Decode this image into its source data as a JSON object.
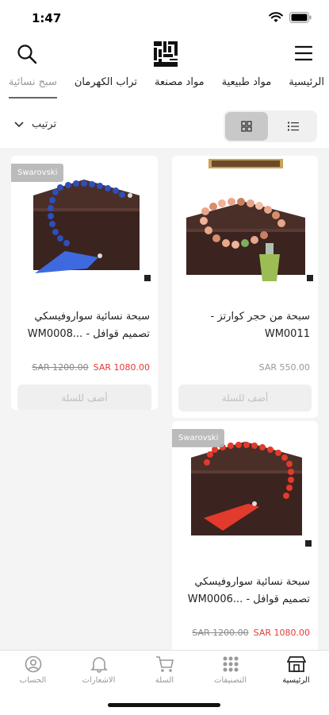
{
  "status": {
    "time": "1:47"
  },
  "header": {
    "logo_alt": "logo-icon"
  },
  "categories": [
    {
      "label": "الرئيسية",
      "active": false
    },
    {
      "label": "مواد طبيعية",
      "active": false
    },
    {
      "label": "مواد مصنعة",
      "active": false
    },
    {
      "label": "تراب الكهرمان",
      "active": false
    },
    {
      "label": "سبح نسائية",
      "active": true
    }
  ],
  "toolbar": {
    "sort_label": "ترتيب"
  },
  "products": [
    {
      "badge": "",
      "title": "سبحة من حجر كوارتز - WM0011",
      "price_old": "",
      "price_new": "SAR 550.00",
      "add_label": "أضف للسلة"
    },
    {
      "badge": "Swarovski",
      "title": "سبحة نسائية سواروفيسكي تصميم قوافل - ...WM0008",
      "price_old": "SAR 1200.00",
      "price_new": "SAR 1080.00",
      "add_label": "أضف للسلة"
    },
    {
      "badge": "Swarovski",
      "title": "سبحة نسائية سواروفيسكي تصميم قوافل - ...WM0006",
      "price_old": "SAR 1200.00",
      "price_new": "SAR 1080.00",
      "add_label": ""
    }
  ],
  "nav": {
    "home": "الرئيسية",
    "categories": "التصنيفات",
    "cart": "السلة",
    "notifications": "الاشعارات",
    "account": "الحساب"
  },
  "colors": {
    "sale": "#e53935",
    "accent": "#222222",
    "muted": "#999999"
  }
}
